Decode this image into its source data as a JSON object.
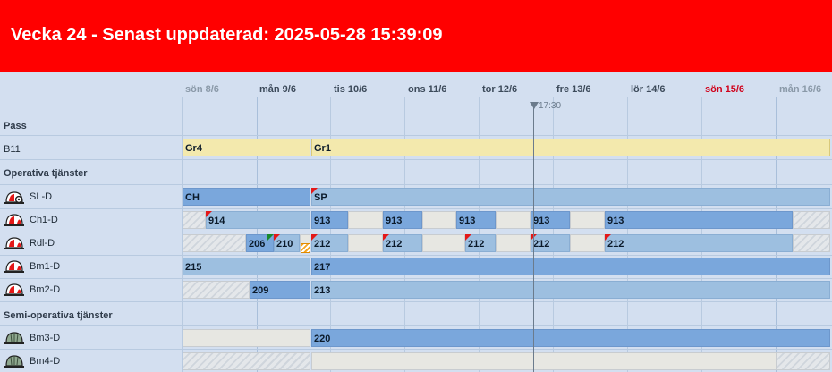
{
  "header": {
    "title": "Vecka 24 - Senast uppdaterad: 2025-05-28 15:39:09"
  },
  "days": [
    "sön 8/6",
    "mån 9/6",
    "tis 10/6",
    "ons 11/6",
    "tor 12/6",
    "fre 13/6",
    "lör 14/6",
    "sön 15/6",
    "mån 16/6"
  ],
  "now_marker": "17:30",
  "sections": {
    "pass": "Pass",
    "operative": "Operativa tjänster",
    "semi": "Semi-operativa tjänster"
  },
  "rows": {
    "b11": {
      "label": "B11",
      "bars": [
        "Gr4",
        "Gr1"
      ]
    },
    "sl_d": {
      "label": "SL-D",
      "bars": [
        "CH",
        "SP"
      ]
    },
    "ch1_d": {
      "label": "Ch1-D",
      "bars": [
        "914",
        "913",
        "913",
        "913",
        "913",
        "913"
      ]
    },
    "rdl_d": {
      "label": "Rdl-D",
      "bars": [
        "206",
        "210",
        "212",
        "212",
        "212",
        "212",
        "212"
      ]
    },
    "bm1_d": {
      "label": "Bm1-D",
      "bars": [
        "215",
        "217"
      ]
    },
    "bm2_d": {
      "label": "Bm2-D",
      "bars": [
        "209",
        "213"
      ]
    },
    "bm3_d": {
      "label": "Bm3-D",
      "bars": [
        "220"
      ]
    },
    "bm4_d": {
      "label": "Bm4-D",
      "bars": []
    }
  },
  "colors": {
    "header_bg": "#ff0000",
    "sunday": "#d0021b",
    "flag": "#e41818"
  }
}
